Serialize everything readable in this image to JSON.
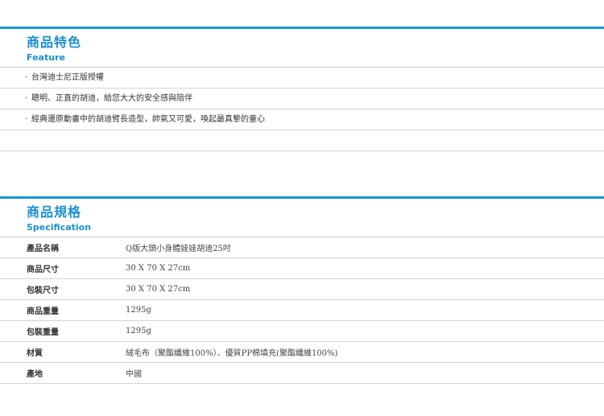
{
  "feature": {
    "title": "商品特色",
    "subtitle": "Feature",
    "items": [
      {
        "bullet": "·",
        "text": "台灣迪士尼正版授權"
      },
      {
        "bullet": "·",
        "text": "聰明、正直的胡迪，給您大大的安全感與陪伴"
      },
      {
        "bullet": "·",
        "text": "經典還原動畫中的胡迪臂長造型，帥氣又可愛，喚起最真摯的童心"
      }
    ]
  },
  "spec": {
    "title": "商品規格",
    "subtitle": "Specification",
    "rows": [
      {
        "label": "產品名稱",
        "value": "Q版大頭小身體娃娃胡迪25吋"
      },
      {
        "label": "商品尺寸",
        "value": "30 X 70 X 27cm"
      },
      {
        "label": "包裝尺寸",
        "value": "30 X 70 X 27cm"
      },
      {
        "label": "商品重量",
        "value": "1295g"
      },
      {
        "label": "包裝重量",
        "value": "1295g"
      },
      {
        "label": "材質",
        "value": "絨毛布（聚酯纖維100%）、優質PP棉填充(聚酯纖維100%)"
      },
      {
        "label": "產地",
        "value": "中國"
      }
    ]
  },
  "colors": {
    "accent": "#1a96d4",
    "divider": "#d4d4d4"
  }
}
